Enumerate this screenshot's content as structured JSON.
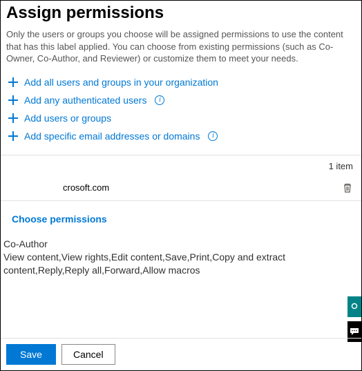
{
  "title": "Assign permissions",
  "description": "Only the users or groups you choose will be assigned permissions to use the content that has this label applied. You can choose from existing permissions (such as Co-Owner, Co-Author, and Reviewer) or customize them to meet your needs.",
  "links": {
    "add_all": "Add all users and groups in your organization",
    "add_auth": "Add any authenticated users",
    "add_users": "Add users or groups",
    "add_email": "Add specific email addresses or domains"
  },
  "item_count": "1 item",
  "table": {
    "rows": [
      {
        "value": "crosoft.com"
      }
    ]
  },
  "choose_label": "Choose permissions",
  "role": "Co-Author",
  "permissions": "View content,View rights,Edit content,Save,Print,Copy and extract content,Reply,Reply all,Forward,Allow macros",
  "buttons": {
    "save": "Save",
    "cancel": "Cancel"
  }
}
